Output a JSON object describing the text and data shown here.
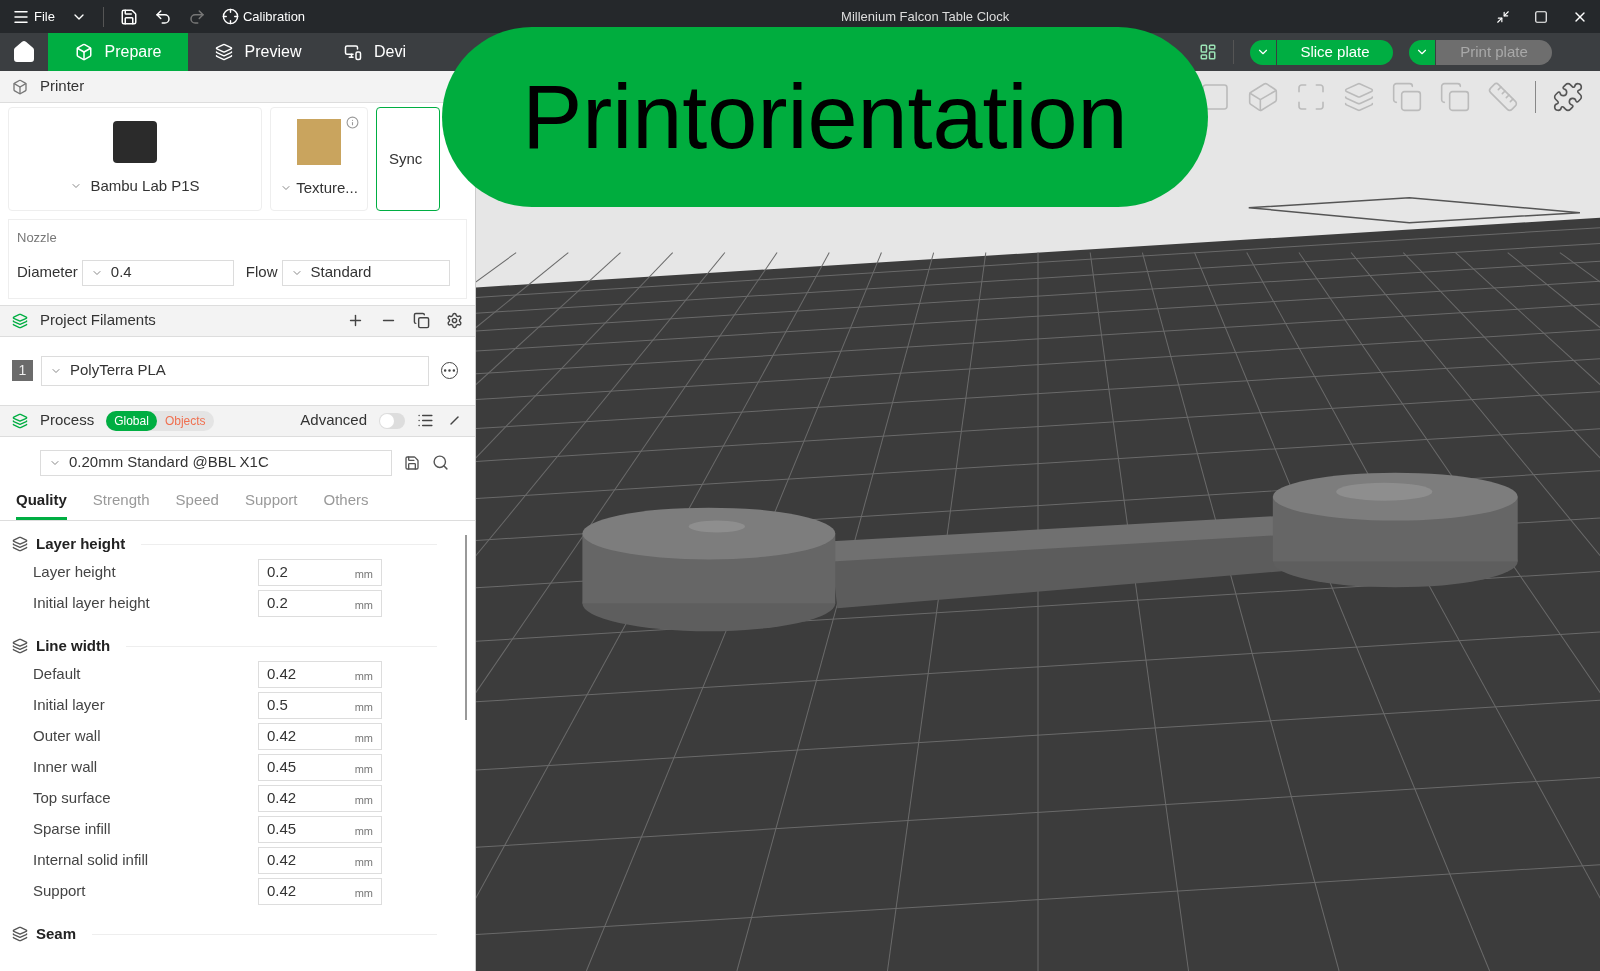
{
  "title_bar": {
    "menu": "File",
    "calibration": "Calibration",
    "title": "Millenium Falcon Table Clock"
  },
  "tabs": [
    {
      "label": "Prepare",
      "selected": true
    },
    {
      "label": "Preview",
      "selected": false
    },
    {
      "label": "Devi",
      "selected": false
    }
  ],
  "actions": [
    {
      "label": "Slice plate",
      "disabled": false
    },
    {
      "label": "Print plate",
      "disabled": true
    }
  ],
  "overlay_banner": {
    "text": "Printorientation"
  },
  "printer": {
    "heading": "Printer",
    "name": "Bambu Lab P1S",
    "plate": "Texture...",
    "sync": "Sync"
  },
  "nozzle": {
    "heading": "Nozzle",
    "diameter_label": "Diameter",
    "diameter": "0.4",
    "flow_label": "Flow",
    "flow": "Standard"
  },
  "filaments": {
    "heading": "Project Filaments",
    "items": [
      {
        "index": "1",
        "name": "PolyTerra PLA"
      }
    ]
  },
  "process": {
    "heading": "Process",
    "scope": [
      {
        "label": "Global",
        "selected": true
      },
      {
        "label": "Objects",
        "selected": false
      }
    ],
    "advanced_label": "Advanced",
    "advanced": false,
    "preset": "0.20mm Standard @BBL X1C",
    "tabs": [
      {
        "label": "Quality",
        "selected": true
      },
      {
        "label": "Strength",
        "selected": false
      },
      {
        "label": "Speed",
        "selected": false
      },
      {
        "label": "Support",
        "selected": false
      },
      {
        "label": "Others",
        "selected": false
      }
    ],
    "groups": [
      {
        "title": "Layer height",
        "settings": [
          {
            "label": "Layer height",
            "value": "0.2",
            "unit": "mm"
          },
          {
            "label": "Initial layer height",
            "value": "0.2",
            "unit": "mm"
          }
        ]
      },
      {
        "title": "Line width",
        "settings": [
          {
            "label": "Default",
            "value": "0.42",
            "unit": "mm"
          },
          {
            "label": "Initial layer",
            "value": "0.5",
            "unit": "mm"
          },
          {
            "label": "Outer wall",
            "value": "0.42",
            "unit": "mm"
          },
          {
            "label": "Inner wall",
            "value": "0.45",
            "unit": "mm"
          },
          {
            "label": "Top surface",
            "value": "0.42",
            "unit": "mm"
          },
          {
            "label": "Sparse infill",
            "value": "0.45",
            "unit": "mm"
          },
          {
            "label": "Internal solid infill",
            "value": "0.42",
            "unit": "mm"
          },
          {
            "label": "Support",
            "value": "0.42",
            "unit": "mm"
          }
        ]
      },
      {
        "title": "Seam"
      }
    ]
  }
}
